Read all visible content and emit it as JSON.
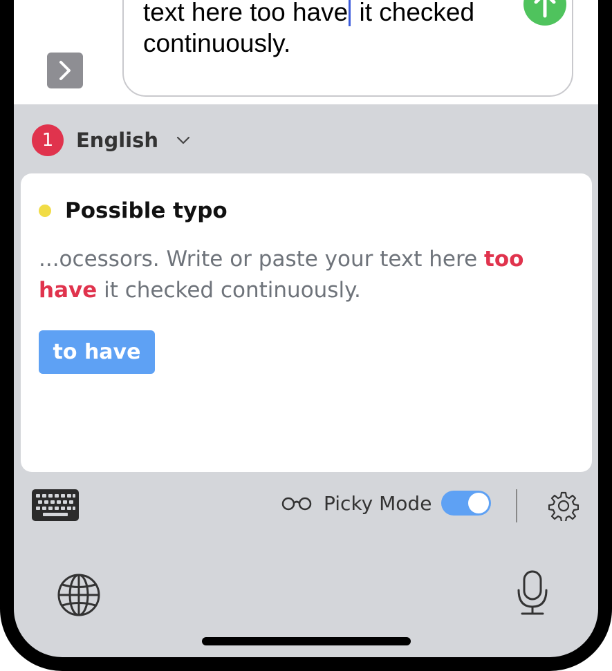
{
  "compose": {
    "text_before_cursor": "processors. Write or paste your text here too have",
    "text_after_cursor": " it checked continuously."
  },
  "language": {
    "issue_count": "1",
    "label": "English"
  },
  "card": {
    "title": "Possible typo",
    "context_before": "...ocessors. Write or paste your text here ",
    "error_text": "too have",
    "context_after": " it checked continuously.",
    "suggestion": "to have"
  },
  "toolbar": {
    "picky_mode_label": "Picky Mode",
    "picky_mode_on": true
  },
  "colors": {
    "send_button": "#4fc35d",
    "issue_badge": "#e0334d",
    "typo_dot": "#f1dc46",
    "accent_blue": "#5ea1f4"
  },
  "icons": [
    "chevron-right-icon",
    "arrow-up-icon",
    "chevron-down-icon",
    "keyboard-icon",
    "glasses-icon",
    "gear-icon",
    "globe-icon",
    "microphone-icon"
  ]
}
